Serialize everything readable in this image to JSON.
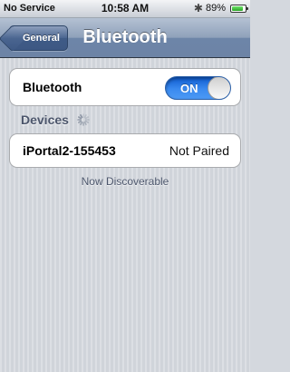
{
  "status_bar": {
    "carrier": "No Service",
    "time": "10:58 AM",
    "bluetooth_icon": "bluetooth-icon",
    "battery_percent": "89%",
    "battery_level": 0.89
  },
  "nav": {
    "back_label": "General",
    "title": "Bluetooth"
  },
  "bluetooth_toggle": {
    "label": "Bluetooth",
    "state_text": "ON",
    "color": "#2f7de6"
  },
  "devices_section": {
    "header": "Devices",
    "spinner_icon": "loading-spinner-icon",
    "items": [
      {
        "name": "iPortal2-155453",
        "status": "Not Paired"
      }
    ],
    "footer": "Now Discoverable"
  }
}
